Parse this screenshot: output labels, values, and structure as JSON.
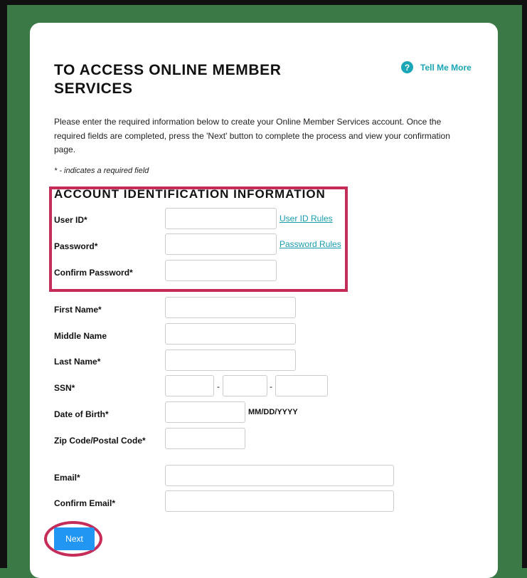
{
  "page": {
    "title": "TO ACCESS ONLINE MEMBER SERVICES",
    "help_link": "Tell Me More",
    "help_icon": "question-circle-icon",
    "intro": "Please enter the required information below to create your Online Member Services account. Once the required fields are completed, press the 'Next' button to complete the process and view your confirmation page.",
    "required_note": "* - indicates a required field"
  },
  "account_section": {
    "title": "ACCOUNT IDENTIFICATION INFORMATION",
    "user_id_label": "User ID*",
    "user_id_value": "",
    "user_id_rules": "User ID Rules",
    "password_label": "Password*",
    "password_value": "",
    "password_rules": "Password Rules",
    "confirm_password_label": "Confirm Password*",
    "confirm_password_value": ""
  },
  "personal": {
    "first_name_label": "First Name*",
    "first_name_value": "",
    "middle_name_label": "Middle Name",
    "middle_name_value": "",
    "last_name_label": "Last Name*",
    "last_name_value": "",
    "ssn_label": "SSN*",
    "ssn_separator": "-",
    "ssn_part1": "",
    "ssn_part2": "",
    "ssn_part3": "",
    "dob_label": "Date of Birth*",
    "dob_value": "",
    "dob_format": "MM/DD/YYYY",
    "zip_label": "Zip Code/Postal Code*",
    "zip_value": "",
    "email_label": "Email*",
    "email_value": "",
    "confirm_email_label": "Confirm Email*",
    "confirm_email_value": ""
  },
  "actions": {
    "next_label": "Next"
  },
  "colors": {
    "background": "#3b7a47",
    "accent": "#1aa6b7",
    "highlight": "#c62c58",
    "button": "#2196f3"
  }
}
